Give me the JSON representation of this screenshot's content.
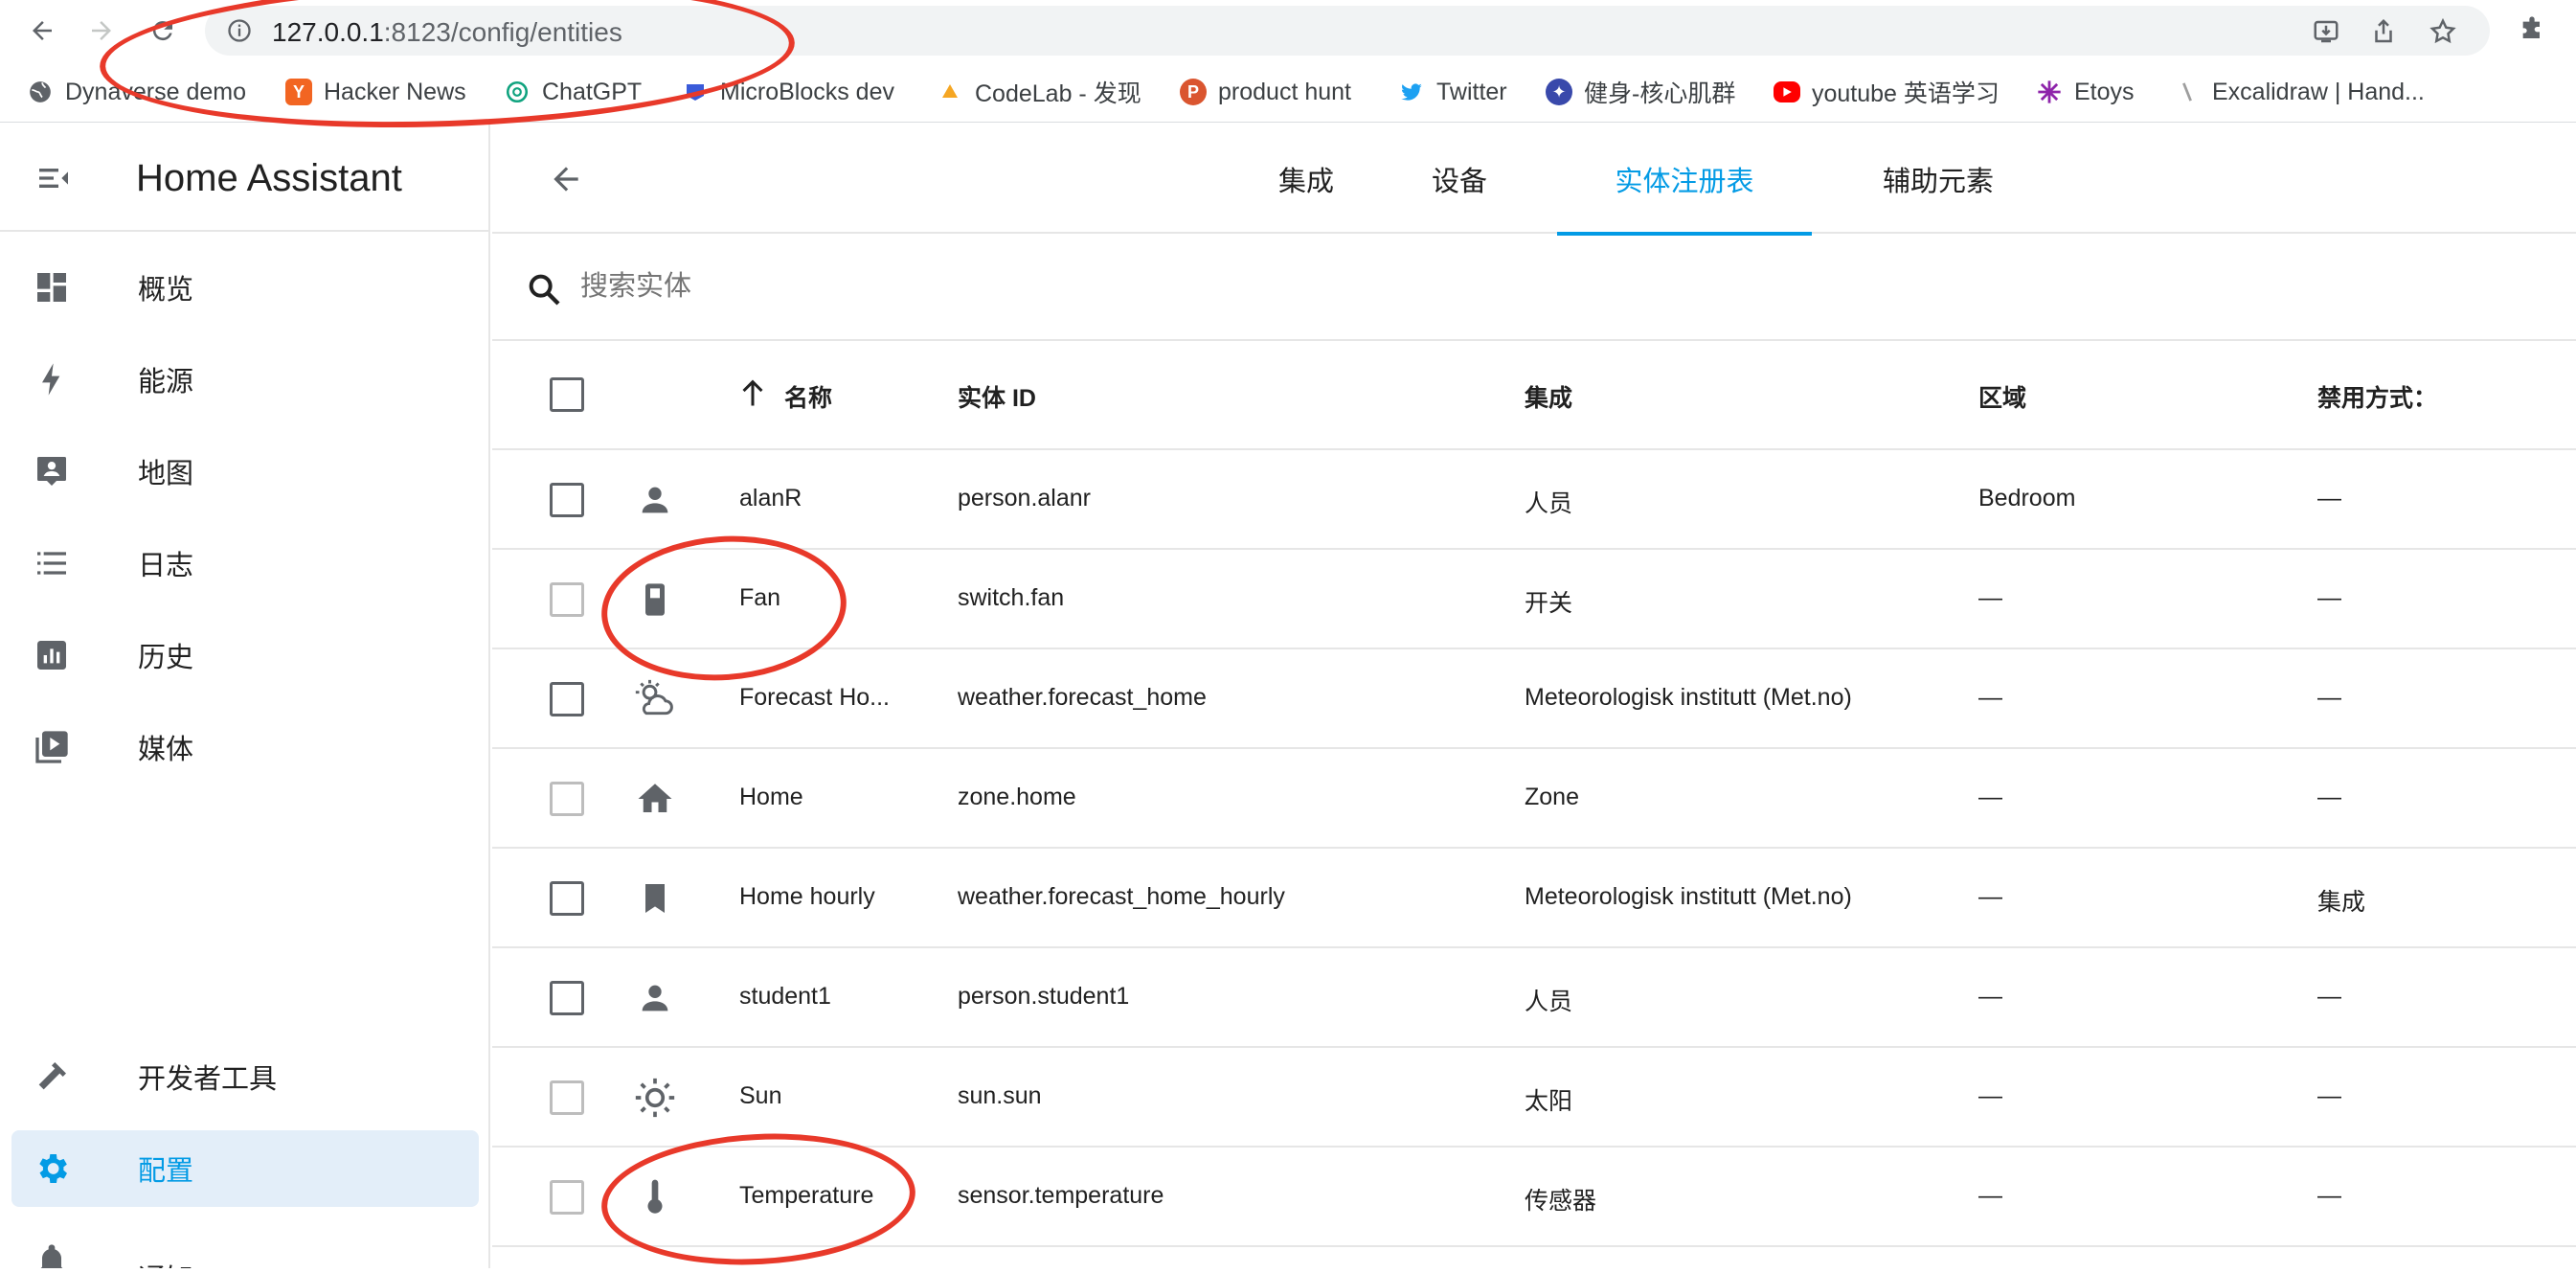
{
  "browser": {
    "url_host": "127.0.0.1",
    "url_path": ":8123/config/entities",
    "bookmarks": [
      {
        "label": "Dynaverse demo",
        "icon": "globe-icon",
        "color": "#5f6368"
      },
      {
        "label": "Hacker News",
        "icon": "y-icon",
        "color": "#f26522"
      },
      {
        "label": "ChatGPT",
        "icon": "openai-icon",
        "color": "#10a37f"
      },
      {
        "label": "MicroBlocks dev",
        "icon": "microblocks-icon",
        "color": "#3a5bd9"
      },
      {
        "label": "CodeLab - 发现",
        "icon": "codelab-icon",
        "color": "#f5a623"
      },
      {
        "label": "product hunt",
        "icon": "p-icon",
        "color": "#da552f"
      },
      {
        "label": "Twitter",
        "icon": "twitter-icon",
        "color": "#1da1f2"
      },
      {
        "label": "健身-核心肌群",
        "icon": "fitness-icon",
        "color": "#3949ab"
      },
      {
        "label": "youtube 英语学习",
        "icon": "youtube-icon",
        "color": "#ff0000"
      },
      {
        "label": "Etoys",
        "icon": "etoys-icon",
        "color": "#8e24aa"
      },
      {
        "label": "Excalidraw | Hand...",
        "icon": "excalidraw-icon",
        "color": "#9e9e9e"
      }
    ]
  },
  "sidebar": {
    "title": "Home Assistant",
    "items": [
      {
        "label": "概览",
        "icon": "dashboard-icon"
      },
      {
        "label": "能源",
        "icon": "lightning-icon"
      },
      {
        "label": "地图",
        "icon": "map-account-icon"
      },
      {
        "label": "日志",
        "icon": "list-icon"
      },
      {
        "label": "历史",
        "icon": "chart-box-icon"
      },
      {
        "label": "媒体",
        "icon": "play-box-icon"
      }
    ],
    "bottom_items": [
      {
        "label": "开发者工具",
        "icon": "hammer-icon"
      },
      {
        "label": "配置",
        "icon": "gear-icon",
        "active": true
      },
      {
        "label": "通知",
        "icon": "bell-icon"
      }
    ]
  },
  "tabs": [
    "集成",
    "设备",
    "实体注册表",
    "辅助元素"
  ],
  "active_tab": "实体注册表",
  "search": {
    "placeholder": "搜索实体"
  },
  "table": {
    "columns": [
      "名称",
      "实体 ID",
      "集成",
      "区域",
      "禁用方式："
    ],
    "rows": [
      {
        "icon": "account-icon",
        "name": "alanR",
        "entity_id": "person.alanr",
        "integration": "人员",
        "area": "Bedroom",
        "disabled_by": "—",
        "checkbox_light": false
      },
      {
        "icon": "switch-icon",
        "name": "Fan",
        "entity_id": "switch.fan",
        "integration": "开关",
        "area": "—",
        "disabled_by": "—",
        "checkbox_light": true
      },
      {
        "icon": "weather-partly-cloudy-icon",
        "name": "Forecast Ho...",
        "entity_id": "weather.forecast_home",
        "integration": "Meteorologisk institutt (Met.no)",
        "area": "—",
        "disabled_by": "—",
        "checkbox_light": false
      },
      {
        "icon": "home-icon",
        "name": "Home",
        "entity_id": "zone.home",
        "integration": "Zone",
        "area": "—",
        "disabled_by": "—",
        "checkbox_light": true
      },
      {
        "icon": "bookmark-icon",
        "name": "Home hourly",
        "entity_id": "weather.forecast_home_hourly",
        "integration": "Meteorologisk institutt (Met.no)",
        "area": "—",
        "disabled_by": "集成",
        "checkbox_light": false
      },
      {
        "icon": "account-icon",
        "name": "student1",
        "entity_id": "person.student1",
        "integration": "人员",
        "area": "—",
        "disabled_by": "—",
        "checkbox_light": false
      },
      {
        "icon": "sun-icon",
        "name": "Sun",
        "entity_id": "sun.sun",
        "integration": "太阳",
        "area": "—",
        "disabled_by": "—",
        "checkbox_light": true
      },
      {
        "icon": "thermometer-icon",
        "name": "Temperature",
        "entity_id": "sensor.temperature",
        "integration": "传感器",
        "area": "—",
        "disabled_by": "—",
        "checkbox_light": true
      }
    ]
  },
  "colors": {
    "accent": "#039be5",
    "annotation": "#e8392a",
    "icon": "#5f6368"
  }
}
